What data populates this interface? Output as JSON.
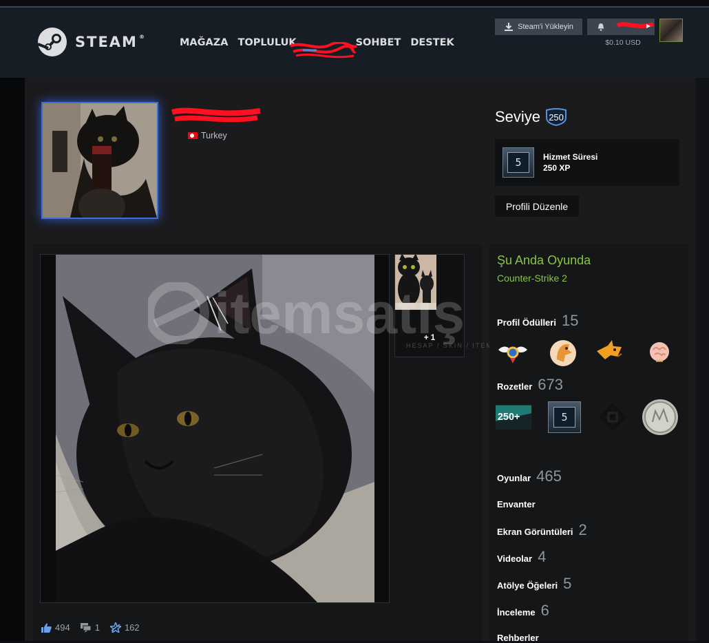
{
  "header": {
    "logo_text": "STEAM",
    "nav": [
      {
        "label": "MAĞAZA"
      },
      {
        "label": "TOPLULUK"
      },
      {
        "label": ""
      },
      {
        "label": "SOHBET"
      },
      {
        "label": "DESTEK"
      }
    ],
    "install_button": "Steam'i Yükleyin",
    "wallet": "$0.10 USD"
  },
  "profile": {
    "country": "Turkey",
    "level_label": "Seviye",
    "level": "250",
    "xp_badge_number": "5",
    "xp_title": "Hizmet Süresi",
    "xp_value": "250 XP",
    "edit_button": "Profili Düzenle"
  },
  "showcase": {
    "more_count": "+ 1",
    "watermark_text": "itemsatış",
    "watermark_sub": "HESAP / SKIN / ITEM / PIN",
    "likes": "494",
    "comments": "1",
    "awards": "162"
  },
  "sidebar": {
    "ingame_label": "Şu Anda Oyunda",
    "ingame_game": "Counter-Strike 2",
    "awards_label": "Profil Ödülleri",
    "awards_count": "15",
    "badges_label": "Rozetler",
    "badges_count": "673",
    "badge_250_text": "250+",
    "badge_5_text": "5",
    "games_label": "Oyunlar",
    "games_count": "465",
    "inventory_label": "Envanter",
    "screenshots_label": "Ekran Görüntüleri",
    "screenshots_count": "2",
    "videos_label": "Videolar",
    "videos_count": "4",
    "workshop_label": "Atölye Öğeleri",
    "workshop_count": "5",
    "reviews_label": "İnceleme",
    "reviews_count": "6",
    "guides_label": "Rehberler"
  },
  "colors": {
    "header_bg": "#171d25",
    "ingame_green": "#8bc53f",
    "level_ring": "#3b6fd0"
  }
}
